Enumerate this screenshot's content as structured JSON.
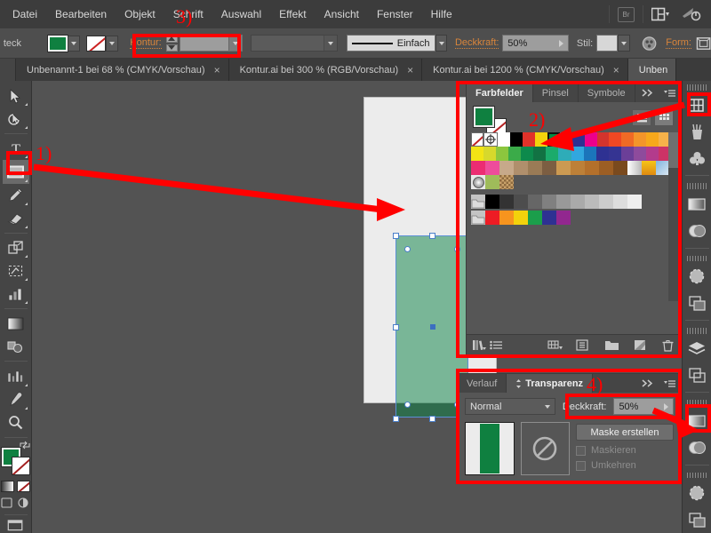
{
  "menubar": {
    "items": [
      "Datei",
      "Bearbeiten",
      "Objekt",
      "Schrift",
      "Auswahl",
      "Effekt",
      "Ansicht",
      "Fenster",
      "Hilfe"
    ],
    "bridge_label": "Br",
    "arrange_icon": "arrange-documents-icon",
    "workspace_icon": "workspace-switcher-icon"
  },
  "controlbar": {
    "shape_label": "teck",
    "fill_swatch": "fill-color-green",
    "stroke_swatch": "stroke-none",
    "stroke_label": "Kontur:",
    "stroke_weight_value": "",
    "stroke_profile_value": "",
    "stroke_style_label": "Einfach",
    "opacity_label": "Deckkraft:",
    "opacity_value": "50%",
    "style_label": "Stil:",
    "style_value": "",
    "shape_label_2": "Form:",
    "recolor_icon": "recolor-artwork-icon",
    "shape_icon": "shape-options-icon"
  },
  "tabs": [
    {
      "label": "Unbenannt-1 bei 68 % (CMYK/Vorschau)",
      "close": "×",
      "active": false
    },
    {
      "label": "Kontur.ai bei 300 % (RGB/Vorschau)",
      "close": "×",
      "active": false
    },
    {
      "label": "Kontur.ai bei 1200 % (CMYK/Vorschau)",
      "close": "×",
      "active": false
    },
    {
      "label": "Unben",
      "close": "",
      "active": true
    }
  ],
  "toolbar": {
    "tools": [
      "selection-tool",
      "direct-selection-tool",
      "type-tool",
      "rectangle-tool",
      "pencil-tool",
      "eraser-tool",
      "free-transform-tool",
      "shape-builder-tool",
      "column-graph-tool",
      "gradient-tool",
      "blend-tool",
      "graph-tool-2",
      "eyedropper-tool",
      "zoom-tool"
    ],
    "selected_tool": "rectangle-tool",
    "fill_stroke": "fill-stroke-indicator",
    "gradient_swatch": "gradient-swatch",
    "none_swatch": "none-swatch",
    "screenmode": "screen-mode-icon"
  },
  "dock": {
    "icons": [
      "swatches-panel-icon",
      "brushes-panel-icon",
      "symbols-panel-icon",
      "gradient-panel-icon",
      "transparency-panel-icon",
      "appearance-panel-icon",
      "graphic-styles-panel-icon",
      "layers-panel-icon",
      "artboards-panel-icon",
      "gradient-panel-icon-2",
      "transparency-panel-icon-2",
      "appearance-panel-icon-2",
      "graphic-styles-panel-icon-2"
    ],
    "highlighted": [
      "swatches-panel-icon",
      "transparency-panel-icon-2"
    ]
  },
  "swatches_panel": {
    "tabs": [
      {
        "label": "Farbfelder",
        "active": true
      },
      {
        "label": "Pinsel",
        "active": false
      },
      {
        "label": "Symbole",
        "active": false
      }
    ],
    "collapse_icon": "collapse-panel-icon",
    "menu_icon": "panel-menu-icon",
    "fill_color": "#0f8040",
    "stroke_color": "none",
    "view_list_icon": "list-view-icon",
    "view_grid_icon": "grid-view-icon",
    "selected_swatch_index": 6,
    "rows": [
      [
        "none",
        "registration",
        "#ffffff",
        "#000000",
        "#e1322a",
        "#f3d20c",
        "#008d45",
        "#0d8fd4",
        "#2e3192",
        "#ec008c",
        "#d4342d",
        "#ef4823",
        "#f06a25",
        "#f4952a",
        "#f7a81b",
        "#f6b24a"
      ],
      [
        "#f2e415",
        "#d7d92c",
        "#8cc63e",
        "#3bab49",
        "#0d8a4c",
        "#127243",
        "#1bab6b",
        "#2eacb8",
        "#31a7df",
        "#1b75bb",
        "#2e3192",
        "#353492",
        "#6b3f98",
        "#8e4b9c",
        "#b33b8c",
        "#cc3366"
      ],
      [
        "#ec2c72",
        "#ee4c9b",
        "#c7a98a",
        "#b08f6c",
        "#9a7b56",
        "#7c5e42",
        "#cc9a52",
        "#bd8038",
        "#b4702b",
        "#9c5e24",
        "#7a4a1e",
        "#ffffff",
        "#f5c518",
        "#7fb4e0"
      ],
      [
        "gradient-radial",
        "pattern-leaf",
        "pattern-dots"
      ],
      [
        "folder",
        "#000000",
        "#333333",
        "#4d4d4d",
        "#666666",
        "#808080",
        "#999999",
        "#aaaaaa",
        "#bbbbbb",
        "#cccccc",
        "#dddddd",
        "#eeeeee"
      ],
      [
        "folder",
        "#ed1c24",
        "#f7941e",
        "#f3d20c",
        "#1b9e4b",
        "#2e3192",
        "#92278f"
      ]
    ],
    "bottom_icons": [
      "swatch-libraries-icon",
      "show-swatch-kinds-icon",
      "new-color-group-icon",
      "swatch-options-icon",
      "new-folder-icon",
      "new-swatch-icon",
      "delete-swatch-icon"
    ]
  },
  "transparency_panel": {
    "tabs": [
      {
        "label": "Verlauf",
        "active": false
      },
      {
        "label": "Transparenz",
        "active": true
      }
    ],
    "collapse_icon": "collapse-panel-icon",
    "menu_icon": "panel-menu-icon",
    "blend_mode": "Normal",
    "opacity_label": "Deckkraft:",
    "opacity_value": "50%",
    "make_mask_label": "Maske erstellen",
    "clip_label": "Maskieren",
    "invert_label": "Umkehren",
    "object_thumb": "object-thumbnail",
    "mask_thumb": "mask-thumbnail-none"
  },
  "annotations": {
    "step1": "1)",
    "step2": "2)",
    "step3": "3)",
    "step4": "4)",
    "color": "#ff0000"
  },
  "canvas": {
    "artboard": "artboard",
    "shape_name": "selected-rectangle",
    "shape_fill": "#108448",
    "shape_opacity": "50%"
  }
}
